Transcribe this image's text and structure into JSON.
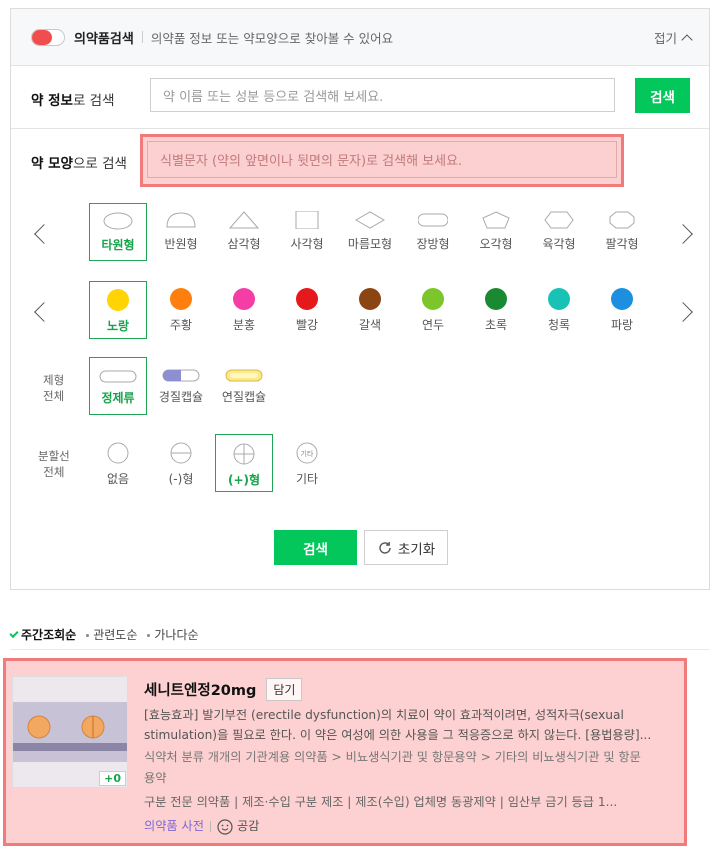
{
  "header": {
    "title": "의약품검색",
    "description": "의약품 정보 또는 약모양으로 찾아볼 수 있어요",
    "collapse_label": "접기"
  },
  "info_search": {
    "label_bold": "약 정보",
    "label_rest": "로 검색",
    "placeholder": "약 이름 또는 성분 등으로 검색해 보세요.",
    "button": "검색"
  },
  "shape_search": {
    "label_bold": "약 모양",
    "label_rest": "으로 검색",
    "placeholder": "식별문자 (약의 앞면이나 뒷면의 문자)로 검색해 보세요."
  },
  "shapes": [
    {
      "label": "타원형",
      "selected": true
    },
    {
      "label": "반원형"
    },
    {
      "label": "삼각형"
    },
    {
      "label": "사각형"
    },
    {
      "label": "마름모형"
    },
    {
      "label": "장방형"
    },
    {
      "label": "오각형"
    },
    {
      "label": "육각형"
    },
    {
      "label": "팔각형"
    }
  ],
  "colors": [
    {
      "label": "노랑",
      "hex": "#ffd400",
      "selected": true
    },
    {
      "label": "주황",
      "hex": "#ff7f0e"
    },
    {
      "label": "분홍",
      "hex": "#f43ea5"
    },
    {
      "label": "빨강",
      "hex": "#e5191c"
    },
    {
      "label": "갈색",
      "hex": "#8b4513"
    },
    {
      "label": "연두",
      "hex": "#7cc52a"
    },
    {
      "label": "초록",
      "hex": "#1a8a32"
    },
    {
      "label": "청록",
      "hex": "#18c3b5"
    },
    {
      "label": "파랑",
      "hex": "#1d8fe0"
    }
  ],
  "forms": {
    "side_label": [
      "제형",
      "전체"
    ],
    "items": [
      {
        "label": "정제류",
        "selected": true
      },
      {
        "label": "경질캡슐"
      },
      {
        "label": "연질캡슐"
      }
    ]
  },
  "score_lines": {
    "side_label": [
      "분할선",
      "전체"
    ],
    "items": [
      {
        "label": "없음"
      },
      {
        "label": "(-)형"
      },
      {
        "label": "(+)형",
        "selected": true
      },
      {
        "label": "기타",
        "icon_text": "기타"
      }
    ]
  },
  "actions": {
    "search": "검색",
    "reset": "초기화"
  },
  "sort": {
    "options": [
      "주간조회순",
      "관련도순",
      "가나다순"
    ],
    "active": "주간조회순"
  },
  "result": {
    "title": "세니트엔정20mg",
    "save_button": "담기",
    "badge": "+0",
    "description_1": "[효능효과] 발기부전 (erectile dysfunction)의 치료이 약이 효과적이려면, 성적자극(sexual",
    "description_2": "stimulation)을 필요로 한다. 이 약은 여성에 의한 사용을 그 적응증으로 하지 않는다. [용법용량]...",
    "classification_1": "식약처 분류  개개의 기관계용 의약품 > 비뇨생식기관 및 항문용약 > 기타의 비뇨생식기관 및 항문",
    "classification_2": "용약",
    "meta": "구분  전문 의약품   |   제조·수입 구분  제조   |   제조(수입) 업체명  동광제약   |   임산부 금기 등급  1...",
    "dictionary_link": "의약품 사전",
    "like_label": "공감"
  }
}
